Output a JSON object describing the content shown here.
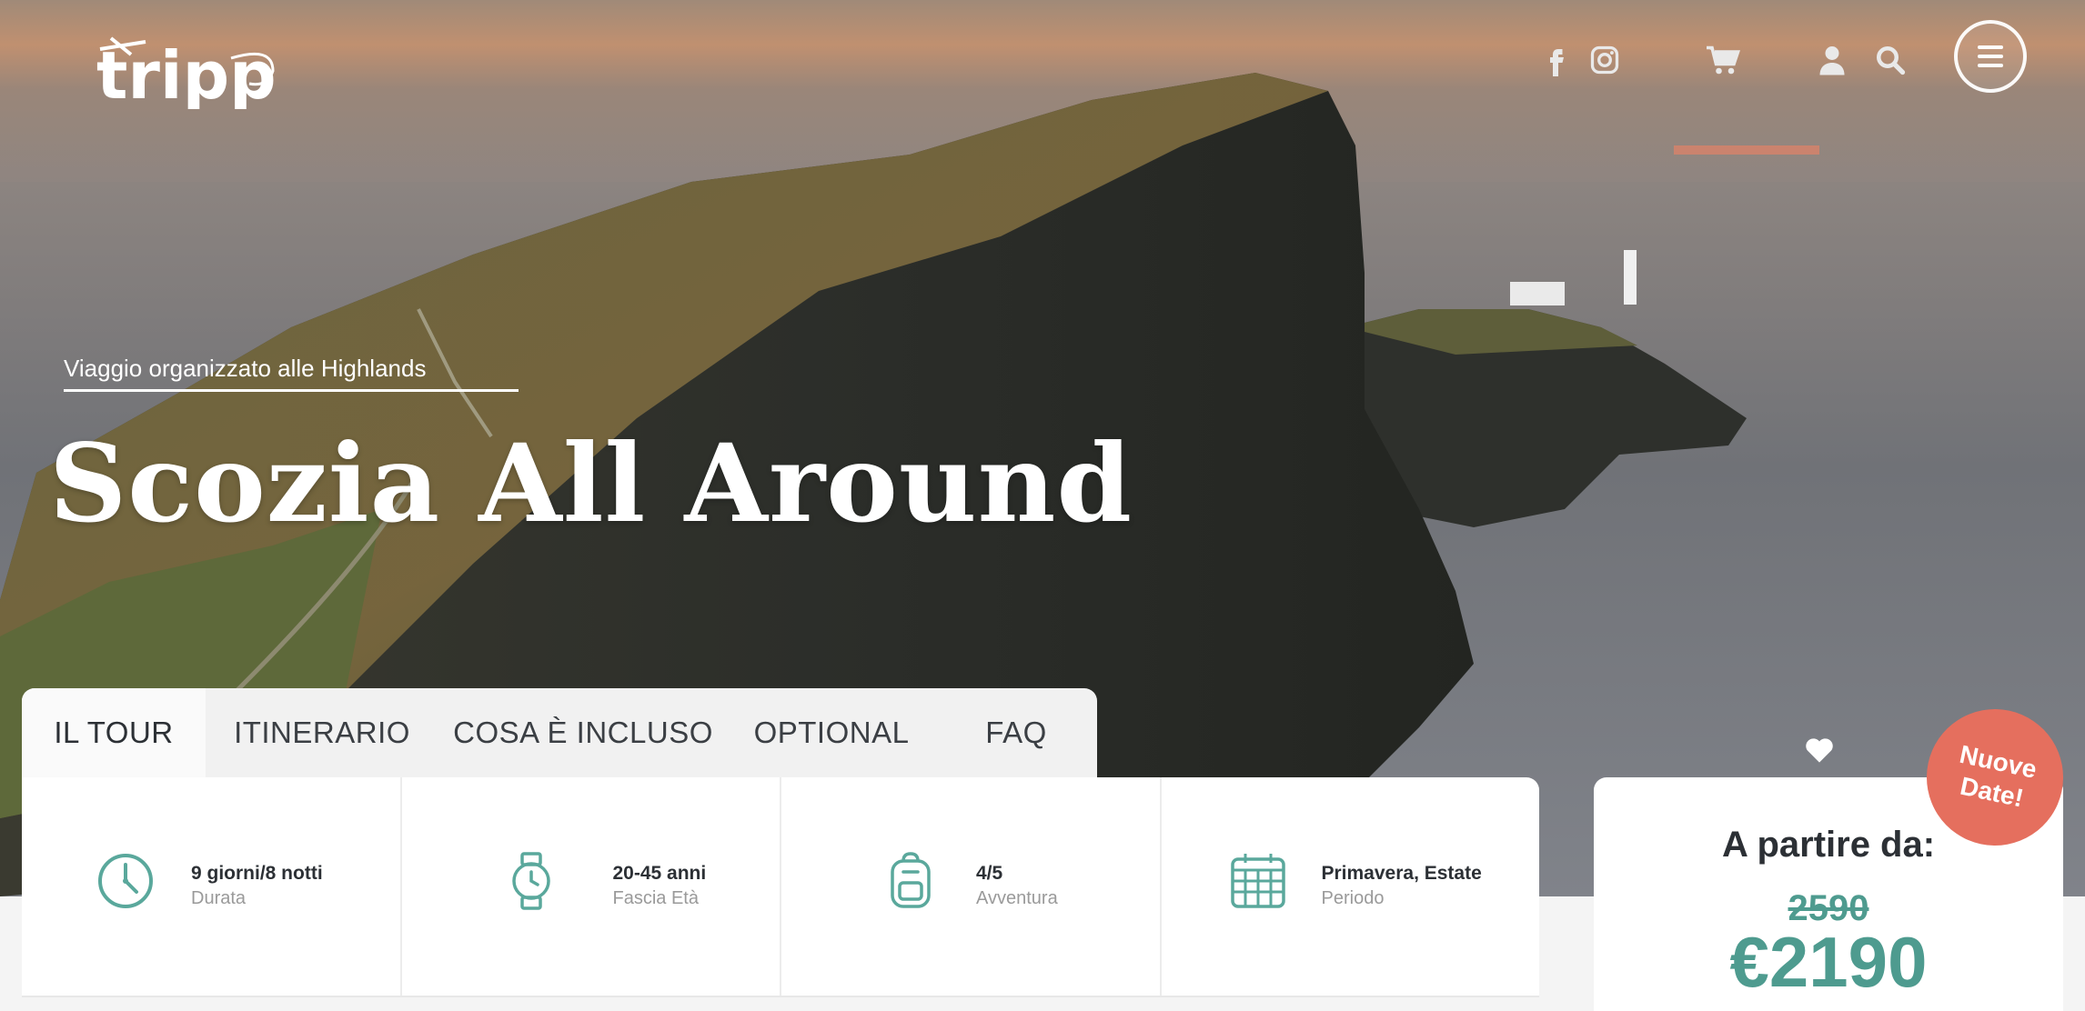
{
  "header": {
    "logo_text": "trippo",
    "icons": [
      "facebook-icon",
      "instagram-icon",
      "cart-icon",
      "user-icon",
      "search-icon",
      "menu-icon"
    ]
  },
  "hero": {
    "subtitle": "Viaggio organizzato alle Highlands",
    "title": "Scozia All Around"
  },
  "tabs": [
    {
      "label": "IL TOUR",
      "active": true
    },
    {
      "label": "ITINERARIO",
      "active": false
    },
    {
      "label": "COSA È INCLUSO",
      "active": false
    },
    {
      "label": "OPTIONAL",
      "active": false
    },
    {
      "label": "FAQ",
      "active": false
    }
  ],
  "info": [
    {
      "icon": "clock-icon",
      "value": "9 giorni/8 notti",
      "label": "Durata"
    },
    {
      "icon": "watch-icon",
      "value": "20-45 anni",
      "label": "Fascia Età"
    },
    {
      "icon": "backpack-icon",
      "value": "4/5",
      "label": "Avventura"
    },
    {
      "icon": "calendar-icon",
      "value": "Primavera, Estate",
      "label": "Periodo"
    }
  ],
  "price": {
    "label": "A partire da:",
    "old": "2590",
    "new": "€2190"
  },
  "badge": {
    "line1": "Nuove",
    "line2": "Date!"
  },
  "colors": {
    "accent": "#4e9b8f",
    "badge": "#e56f5e",
    "text": "#2c3035"
  }
}
